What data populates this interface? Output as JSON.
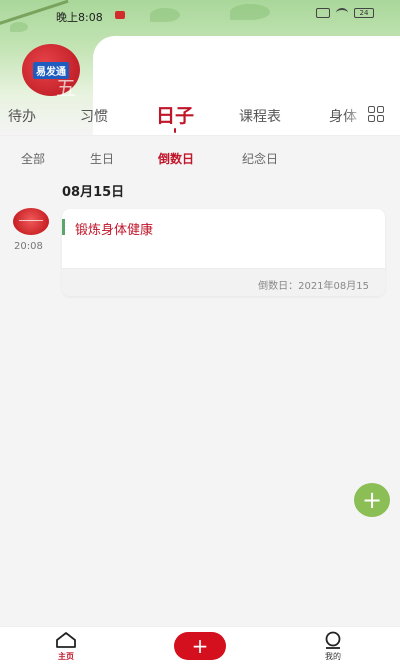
{
  "status_bar": {
    "time": "晚上8:08",
    "battery": "24"
  },
  "profile": {
    "avatar_text": "易发通",
    "deco_text": "五"
  },
  "main_tabs": [
    {
      "label": "待办",
      "active": false
    },
    {
      "label": "习惯",
      "active": false
    },
    {
      "label": "日子",
      "active": true
    },
    {
      "label": "课程表",
      "active": false
    },
    {
      "label": "身体",
      "active": false
    }
  ],
  "filters": [
    {
      "label": "全部",
      "active": false
    },
    {
      "label": "生日",
      "active": false
    },
    {
      "label": "倒数日",
      "active": true
    },
    {
      "label": "纪念日",
      "active": false
    }
  ],
  "day_group": {
    "date": "08月15日",
    "entries": [
      {
        "time": "20:08",
        "title": "锻炼身体健康",
        "countdown": "倒数日：2021年08月15"
      }
    ]
  },
  "bottom_nav": {
    "home_label": "主页",
    "add_label": "+",
    "mine_label": "我的"
  },
  "icons": {
    "grid": "grid-icon",
    "fab": "plus-icon",
    "home": "home-icon",
    "mine": "user-icon"
  },
  "colors": {
    "accent": "#c0162a",
    "fab": "#8bbe55",
    "add_button": "#d4101f"
  }
}
